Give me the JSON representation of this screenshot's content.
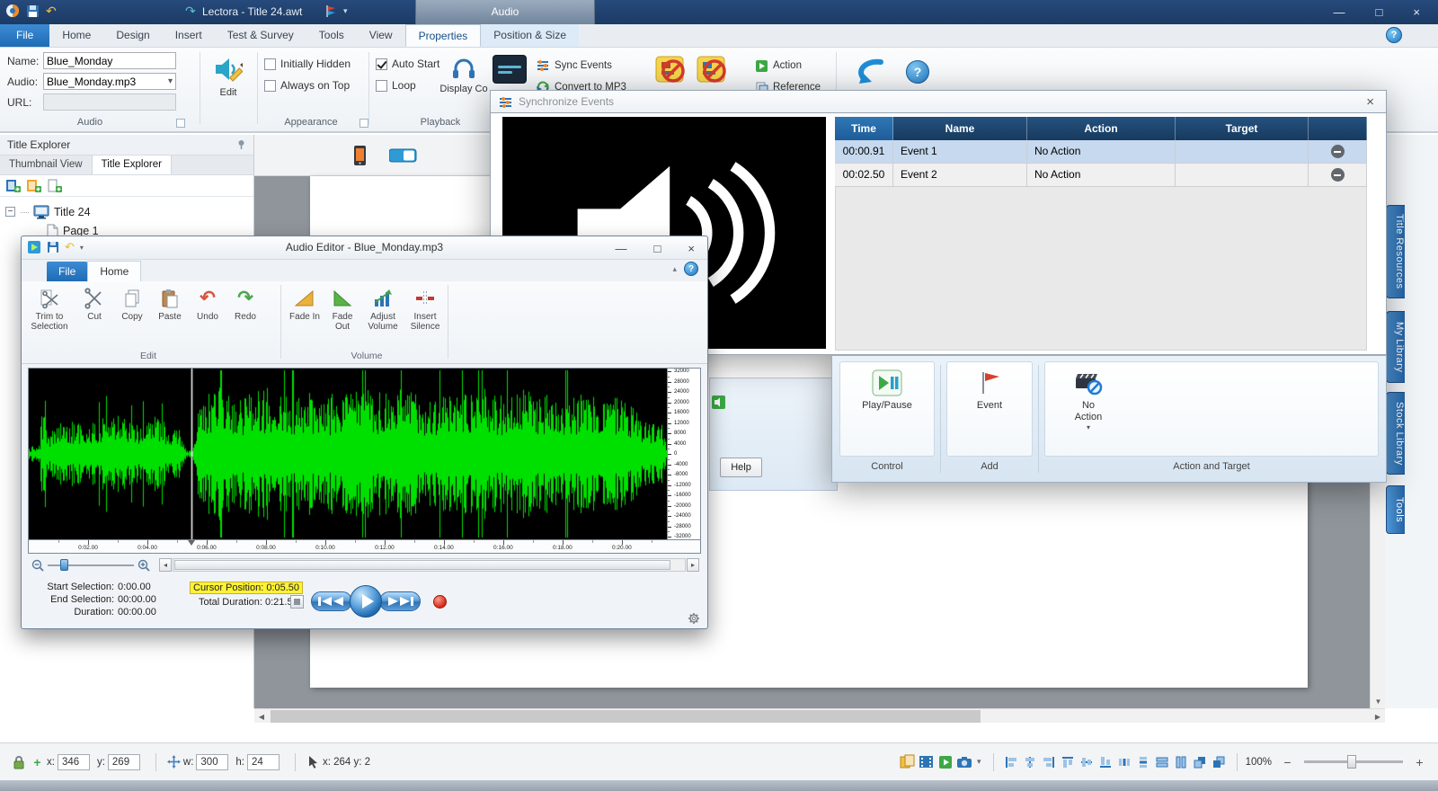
{
  "main_window": {
    "titlebar": {
      "title": "Lectora - Title 24.awt",
      "context_group": "Audio"
    },
    "tabs": [
      {
        "label": "File"
      },
      {
        "label": "Home"
      },
      {
        "label": "Design"
      },
      {
        "label": "Insert"
      },
      {
        "label": "Test & Survey"
      },
      {
        "label": "Tools"
      },
      {
        "label": "View"
      },
      {
        "label": "Properties"
      },
      {
        "label": "Position & Size"
      }
    ],
    "ribbon": {
      "name_label": "Name:",
      "name_value": "Blue_Monday",
      "audio_label": "Audio:",
      "audio_value": "Blue_Monday.mp3",
      "url_label": "URL:",
      "edit_label": "Edit",
      "audio_group_label": "Audio",
      "initially_hidden_label": "Initially Hidden",
      "always_on_top_label": "Always on Top",
      "appearance_group_label": "Appearance",
      "auto_start_label": "Auto Start",
      "loop_label": "Loop",
      "display_label": "Display Co",
      "playback_group_label": "Playback",
      "sync_events_label": "Sync Events",
      "convert_label": "Convert to MP3",
      "action_label": "Action",
      "reference_label": "Reference"
    },
    "explorer": {
      "header": "Title Explorer",
      "tab_thumbnail": "Thumbnail View",
      "tab_explorer": "Title Explorer",
      "tree_title": "Title 24",
      "tree_page": "Page 1"
    },
    "side_tabs": [
      {
        "label": "Title Resources"
      },
      {
        "label": "My Library"
      },
      {
        "label": "Stock Library"
      },
      {
        "label": "Tools"
      }
    ],
    "statusbar": {
      "x_label": "x:",
      "x_value": "346",
      "y_label": "y:",
      "y_value": "269",
      "w_label": "w:",
      "w_value": "300",
      "h_label": "h:",
      "h_value": "24",
      "pointer_label": "x: 264 y: 2",
      "zoom_value": "100%"
    },
    "background_dialog": {
      "help_label": "Help"
    }
  },
  "sync_window": {
    "title": "Synchronize Events",
    "table": {
      "headers": [
        "Time",
        "Name",
        "Action",
        "Target"
      ],
      "rows": [
        {
          "time": "00:00.91",
          "name": "Event 1",
          "action": "No Action",
          "target": ""
        },
        {
          "time": "00:02.50",
          "name": "Event 2",
          "action": "No Action",
          "target": ""
        }
      ]
    },
    "play_pause_label": "Play/Pause",
    "event_label": "Event",
    "no_action_label": "No Action",
    "control_group_label": "Control",
    "add_group_label": "Add",
    "action_target_group_label": "Action and Target"
  },
  "audio_editor": {
    "title": "Audio Editor - Blue_Monday.mp3",
    "file_tab": "File",
    "home_tab": "Home",
    "buttons": {
      "trim": "Trim to Selection",
      "cut": "Cut",
      "copy": "Copy",
      "paste": "Paste",
      "undo": "Undo",
      "redo": "Redo",
      "fade_in": "Fade In",
      "fade_out": "Fade Out",
      "adjust_volume": "Adjust Volume",
      "insert_silence": "Insert Silence"
    },
    "edit_group_label": "Edit",
    "volume_group_label": "Volume",
    "scale_labels": [
      "32000",
      "28000",
      "24000",
      "20000",
      "16000",
      "12000",
      "8000",
      "4000",
      "0",
      "-4000",
      "-8000",
      "-12000",
      "-16000",
      "-20000",
      "-24000",
      "-28000",
      "-32000"
    ],
    "time_labels": [
      "0:02.00",
      "0:04.00",
      "0:06.00",
      "0:08.00",
      "0:10.00",
      "0:12.00",
      "0:14.00",
      "0:16.00",
      "0:18.00",
      "0:20.00"
    ],
    "status": {
      "start_label": "Start Selection:",
      "start_value": "0:00.00",
      "end_label": "End Selection:",
      "end_value": "00:00.00",
      "dur_label": "Duration:",
      "dur_value": "00:00.00",
      "cursor_label": "Cursor Position:",
      "cursor_value": "0:05.50",
      "total_label": "Total Duration:",
      "total_value": "0:21.52"
    },
    "waveform": {
      "color": "#00e000",
      "background": "#000000",
      "cursor_color": "#ffffff",
      "total_seconds": 21.52,
      "cursor_seconds": 5.5,
      "envelope": [
        [
          0,
          0.04
        ],
        [
          0.35,
          0.1
        ],
        [
          0.5,
          0.5
        ],
        [
          0.65,
          0.25
        ],
        [
          1.2,
          0.42
        ],
        [
          2.0,
          0.34
        ],
        [
          2.8,
          0.5
        ],
        [
          3.5,
          0.38
        ],
        [
          4.2,
          0.46
        ],
        [
          4.8,
          0.34
        ],
        [
          5.15,
          0.28
        ],
        [
          5.3,
          0.04
        ],
        [
          5.55,
          0.05
        ],
        [
          5.75,
          0.65
        ],
        [
          6.2,
          0.82
        ],
        [
          7,
          0.72
        ],
        [
          8,
          0.8
        ],
        [
          9,
          0.68
        ],
        [
          9.8,
          0.78
        ],
        [
          10.5,
          0.7
        ],
        [
          11.2,
          0.8
        ],
        [
          12,
          0.72
        ],
        [
          12.8,
          0.8
        ],
        [
          13.6,
          0.68
        ],
        [
          14.4,
          0.75
        ],
        [
          15.2,
          0.8
        ],
        [
          16,
          0.7
        ],
        [
          16.8,
          0.78
        ],
        [
          17.6,
          0.7
        ],
        [
          18.4,
          0.76
        ],
        [
          19.2,
          0.66
        ],
        [
          20,
          0.72
        ],
        [
          20.6,
          0.5
        ],
        [
          21.0,
          0.35
        ],
        [
          21.3,
          0.45
        ],
        [
          21.52,
          0.06
        ]
      ]
    }
  }
}
